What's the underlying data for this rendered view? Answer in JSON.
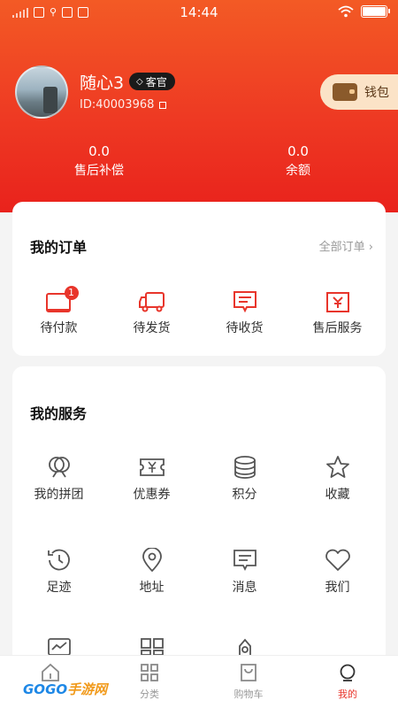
{
  "status_bar": {
    "time": "14:44"
  },
  "profile": {
    "name": "随心3",
    "badge": "客官",
    "id_text": "ID:40003968",
    "wallet_label": "钱包"
  },
  "stats": [
    {
      "value": "0.0",
      "label": "售后补偿"
    },
    {
      "value": "0.0",
      "label": "余额"
    }
  ],
  "orders": {
    "title": "我的订单",
    "all_link": "全部订单 ›",
    "items": [
      {
        "label": "待付款",
        "icon": "wallet-card-icon",
        "badge": "1"
      },
      {
        "label": "待发货",
        "icon": "truck-icon"
      },
      {
        "label": "待收货",
        "icon": "message-box-icon"
      },
      {
        "label": "售后服务",
        "icon": "yen-return-icon"
      }
    ]
  },
  "services": {
    "title": "我的服务",
    "items": [
      {
        "label": "我的拼团",
        "icon": "group-buy-icon"
      },
      {
        "label": "优惠券",
        "icon": "coupon-icon"
      },
      {
        "label": "积分",
        "icon": "coins-icon"
      },
      {
        "label": "收藏",
        "icon": "star-icon"
      },
      {
        "label": "足迹",
        "icon": "history-icon"
      },
      {
        "label": "地址",
        "icon": "location-pin-icon"
      },
      {
        "label": "消息",
        "icon": "message-icon"
      },
      {
        "label": "我们",
        "icon": "heart-icon"
      }
    ]
  },
  "tabbar": {
    "items": [
      {
        "label": "",
        "icon": "home-icon"
      },
      {
        "label": "分类",
        "icon": "category-icon"
      },
      {
        "label": "购物车",
        "icon": "cart-icon"
      },
      {
        "label": "我的",
        "icon": "profile-icon",
        "active": true
      }
    ]
  },
  "watermark": {
    "part1": "GOGO",
    "part2": "手游网"
  },
  "colors": {
    "accent": "#e8352b",
    "header_top": "#f35a25",
    "header_bottom": "#e9221c",
    "wallet_bg": "#fbe3c7"
  }
}
